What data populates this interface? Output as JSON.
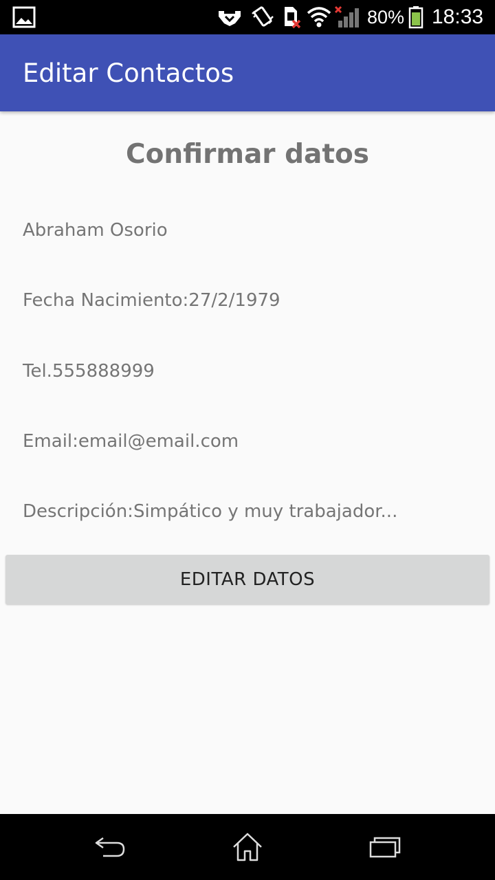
{
  "status_bar": {
    "icons": [
      "image-icon",
      "handshake-icon",
      "vibrate-icon",
      "sim-error-icon",
      "wifi-icon",
      "signal-no-service-icon",
      "battery-icon"
    ],
    "battery_percent": "80%",
    "time": "18:33",
    "battery_color": "#8bc34a"
  },
  "app_bar": {
    "title": "Editar Contactos",
    "color": "#3f51b5"
  },
  "main": {
    "heading": "Confirmar datos",
    "name": "Abraham Osorio",
    "birth_date": "Fecha Nacimiento:27/2/1979",
    "phone": "Tel.555888999",
    "email": "Email:email@email.com",
    "description": "Descripción:Simpático y muy trabajador...",
    "edit_button_label": "EDITAR DATOS"
  },
  "nav_bar": {
    "buttons": [
      "back-icon",
      "home-icon",
      "recents-icon"
    ]
  }
}
